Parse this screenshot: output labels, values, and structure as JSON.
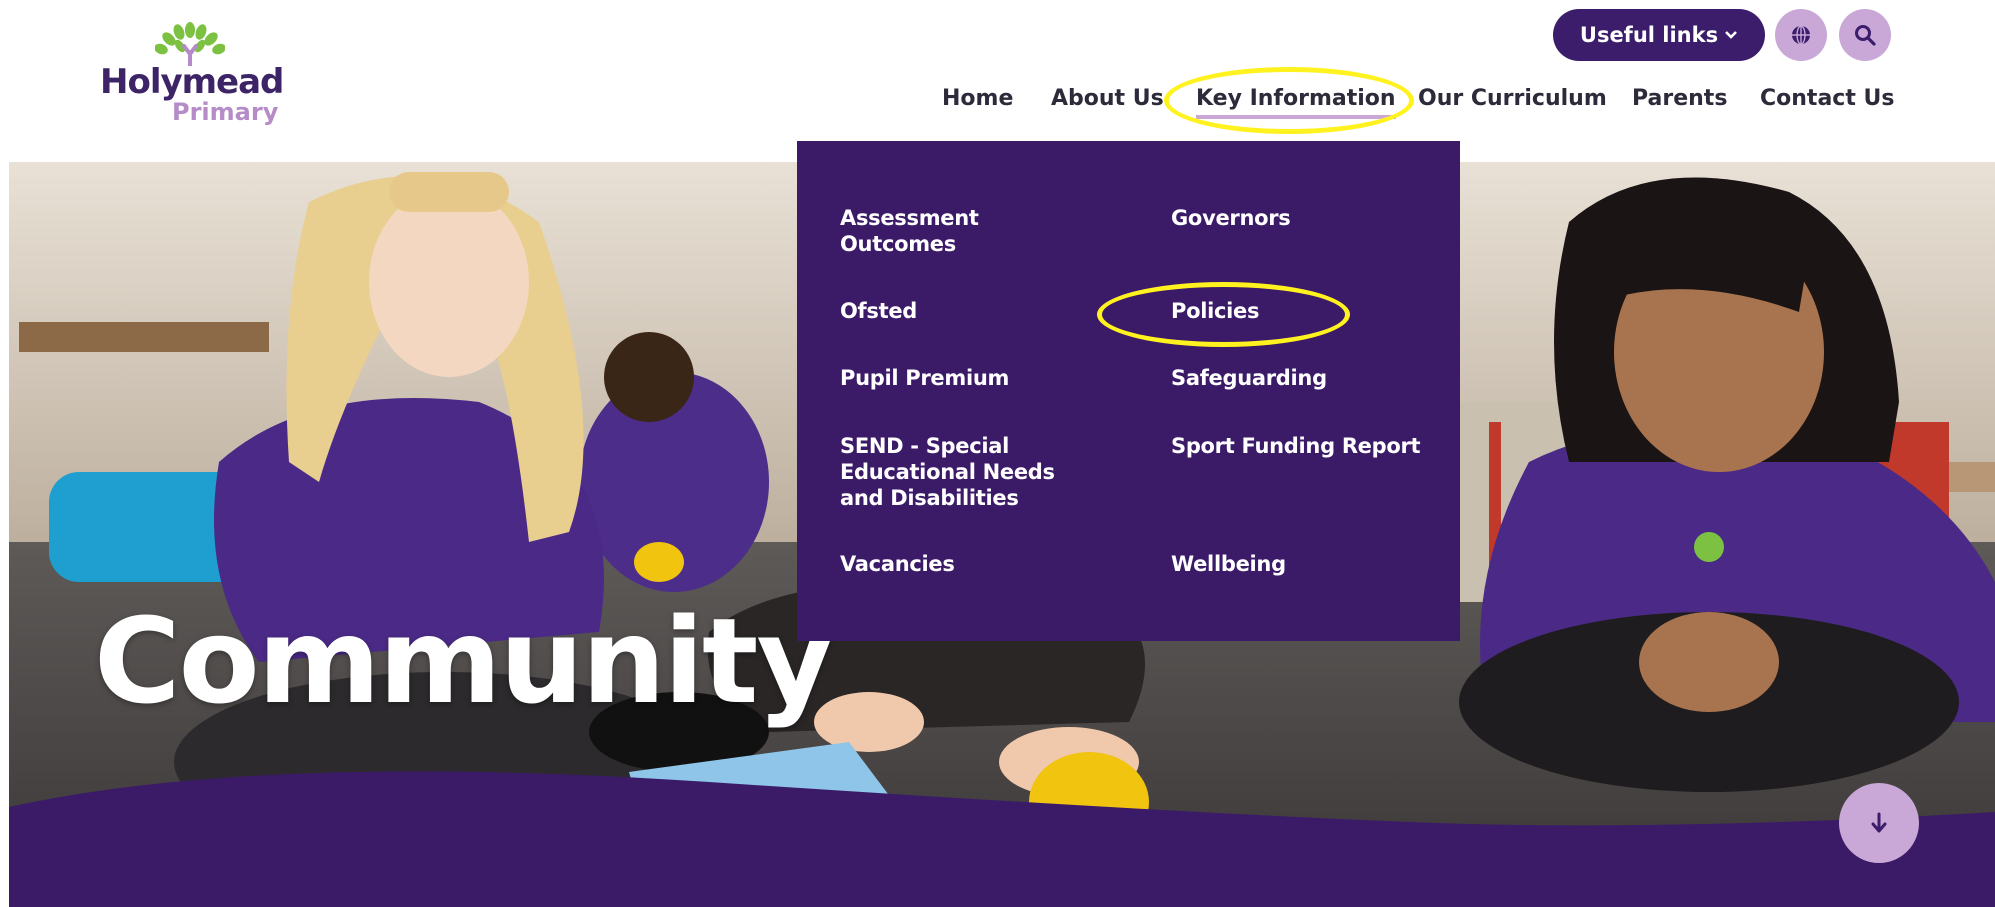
{
  "brand": {
    "name": "Holymead",
    "sub": "Primary"
  },
  "header": {
    "useful_links": "Useful links",
    "chevron": "⌄"
  },
  "nav": [
    {
      "label": "Home"
    },
    {
      "label": "About Us"
    },
    {
      "label": "Key Information",
      "active": true
    },
    {
      "label": "Our Curriculum"
    },
    {
      "label": "Parents"
    },
    {
      "label": "Contact Us"
    }
  ],
  "dropdown": {
    "col1": [
      "Assessment Outcomes",
      "Ofsted",
      "Pupil Premium",
      "SEND - Special Educational Needs and Disabilities",
      "Vacancies"
    ],
    "col2": [
      "Governors",
      "Policies",
      "Safeguarding",
      "Sport Funding Report",
      "Wellbeing"
    ]
  },
  "hero": {
    "title": "Community"
  },
  "icons": {
    "globe": "globe-icon",
    "search": "search-icon",
    "scroll": "arrow-down-icon"
  },
  "colors": {
    "brand_purple": "#3b1d6b",
    "accent_lilac": "#c9a8d8",
    "annotation_yellow": "#fff21e"
  }
}
